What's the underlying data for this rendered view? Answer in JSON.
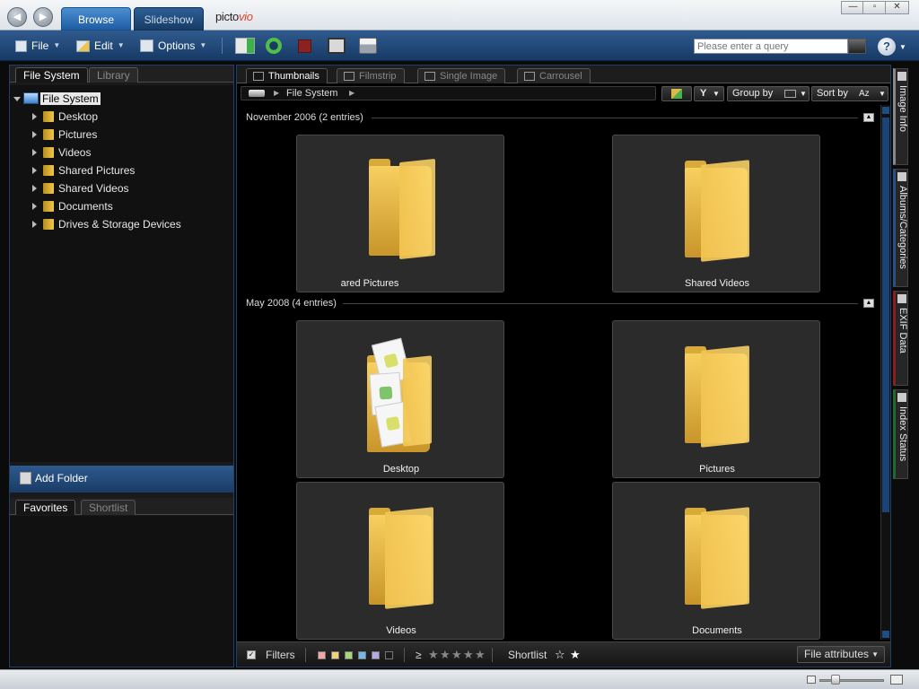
{
  "app": {
    "tabs": [
      "Browse",
      "Slideshow"
    ],
    "logo_prefix": "picto",
    "logo_suffix": "vio"
  },
  "toolbar": {
    "file_label": "File",
    "edit_label": "Edit",
    "options_label": "Options",
    "search_placeholder": "Please enter a query",
    "help_label": "?"
  },
  "left": {
    "tabs": [
      "File System",
      "Library"
    ],
    "root_label": "File System",
    "tree_items": [
      "Desktop",
      "Pictures",
      "Videos",
      "Shared Pictures",
      "Shared Videos",
      "Documents",
      "Drives & Storage Devices"
    ],
    "add_folder_label": "Add Folder",
    "bottom_tabs": [
      "Favorites",
      "Shortlist"
    ]
  },
  "main": {
    "view_tabs": [
      "Thumbnails",
      "Filmstrip",
      "Single Image",
      "Carrousel"
    ],
    "breadcrumb": "File System",
    "group_by_label": "Group by",
    "sort_by_label": "Sort by",
    "sort_icon_text": "Az",
    "groups": [
      {
        "title": "November 2006 (2 entries)",
        "items": [
          "ared Pictures",
          "Shared Videos"
        ]
      },
      {
        "title": "May 2008 (4 entries)",
        "items": [
          "Desktop",
          "Pictures",
          "Videos",
          "Documents"
        ]
      }
    ]
  },
  "filterbar": {
    "filters_label": "Filters",
    "geq_label": "≥",
    "shortlist_label": "Shortlist",
    "file_attributes_label": "File attributes",
    "swatch_colors": [
      "#f3a6a6",
      "#f3d27a",
      "#a8d77a",
      "#78b6e8",
      "#b8a8e8",
      "#1a1a1a"
    ]
  },
  "sidetabs": [
    "Image Info",
    "Albums/Categories",
    "EXIF Data",
    "Index Status"
  ],
  "colors": {
    "accent_blue": "#1f5da3",
    "folder_yellow": "#f2c552",
    "sidetab_albums": "#2a4f82",
    "sidetab_exif": "#8b1e1e",
    "sidetab_index": "#1f6b2e"
  }
}
